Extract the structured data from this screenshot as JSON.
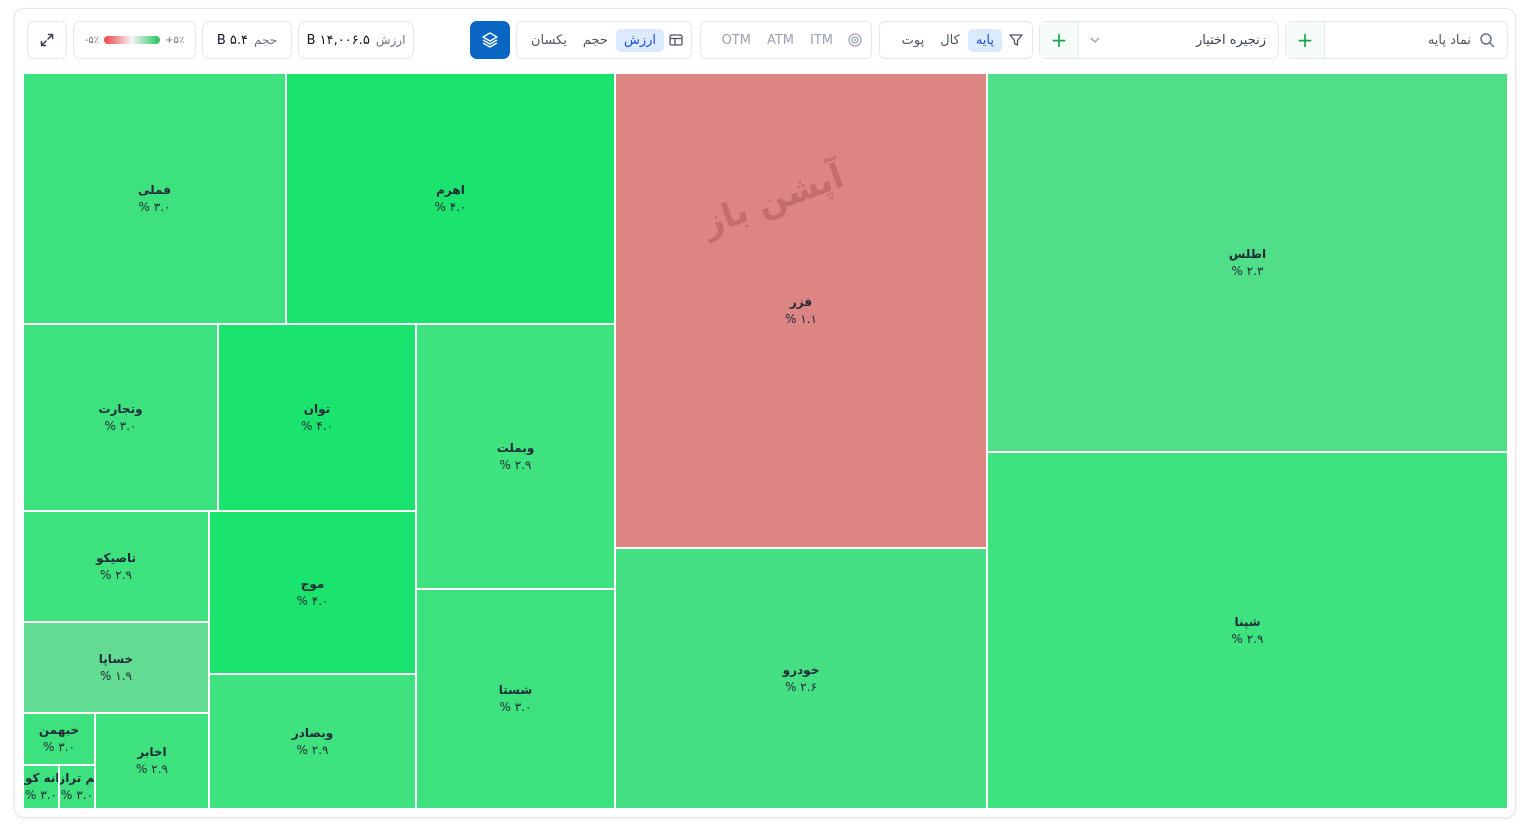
{
  "toolbar": {
    "search_placeholder": "نماد پایه",
    "chain_label": "زنجیره اختیار",
    "filters": {
      "base": "پایه",
      "call": "کال",
      "put": "پوت"
    },
    "moneyness": {
      "itm": "ITM",
      "atm": "ATM",
      "otm": "OTM"
    },
    "weights": {
      "value": "ارزش",
      "volume": "حجم",
      "equal": "یکسان"
    },
    "stats": {
      "value_label": "ارزش",
      "value": "۱۴,۰۰۶.۵ B",
      "volume_label": "حجم",
      "volume": "۵.۴ B"
    },
    "legend": {
      "min": "-۵٪",
      "max": "+۵٪"
    }
  },
  "colors": {
    "accent": "#0a66c2",
    "up_strong": "#1ae36e",
    "up": "#40e080",
    "down": "#dc8582"
  },
  "watermark": "آپشن باز",
  "treemap": [
    {
      "name": "اطلس",
      "pct": "۲.۳ %"
    },
    {
      "name": "شپنا",
      "pct": "۲.۹ %"
    },
    {
      "name": "فزر",
      "pct": "۱.۱ %"
    },
    {
      "name": "خودرو",
      "pct": "۲.۶ %"
    },
    {
      "name": "اهرم",
      "pct": "۴.۰ %"
    },
    {
      "name": "فملی",
      "pct": "۳.۰ %"
    },
    {
      "name": "وبملت",
      "pct": "۲.۹ %"
    },
    {
      "name": "شستا",
      "pct": "۳.۰ %"
    },
    {
      "name": "توان",
      "pct": "۴.۰ %"
    },
    {
      "name": "وتجارت",
      "pct": "۳.۰ %"
    },
    {
      "name": "موج",
      "pct": "۴.۰ %"
    },
    {
      "name": "وبصادر",
      "pct": "۲.۹ %"
    },
    {
      "name": "تاصیکو",
      "pct": "۲.۹ %"
    },
    {
      "name": "خساپا",
      "pct": "۱.۹ %"
    },
    {
      "name": "اخابر",
      "pct": "۲.۹ %"
    },
    {
      "name": "خبهمن",
      "pct": "۳.۰ %"
    },
    {
      "name": "هم ترازو",
      "pct": "۳.۰ %"
    },
    {
      "name": "دانه کوچ",
      "pct": "۳.۰ %"
    }
  ]
}
